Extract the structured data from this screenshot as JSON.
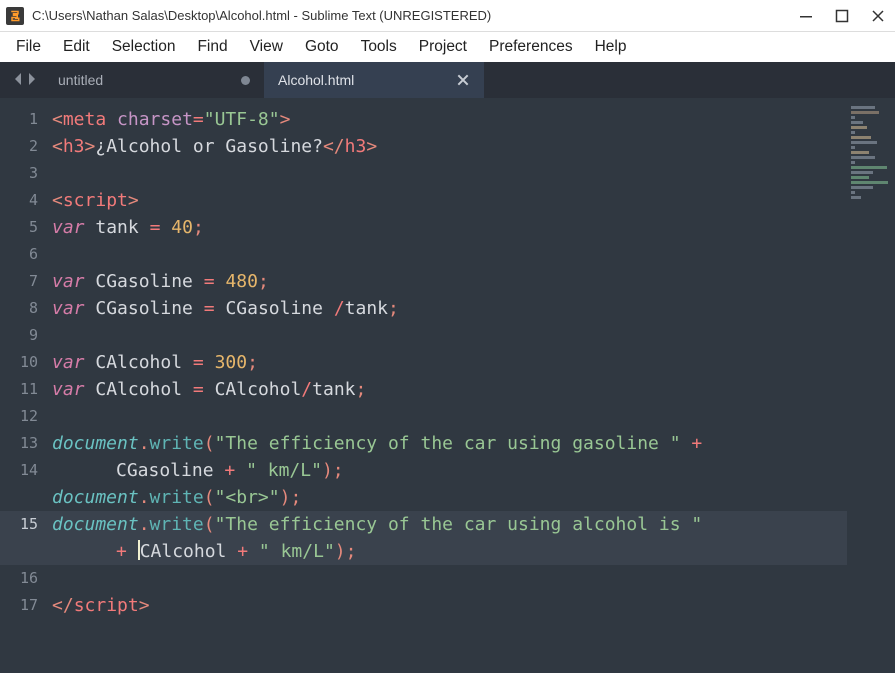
{
  "window": {
    "title": "C:\\Users\\Nathan Salas\\Desktop\\Alcohol.html - Sublime Text (UNREGISTERED)"
  },
  "menu": {
    "file": "File",
    "edit": "Edit",
    "selection": "Selection",
    "find": "Find",
    "view": "View",
    "goto": "Goto",
    "tools": "Tools",
    "project": "Project",
    "preferences": "Preferences",
    "help": "Help"
  },
  "tabs": {
    "t0": {
      "label": "untitled"
    },
    "t1": {
      "label": "Alcohol.html"
    }
  },
  "gutter": {
    "l1": "1",
    "l2": "2",
    "l3": "3",
    "l4": "4",
    "l5": "5",
    "l6": "6",
    "l7": "7",
    "l8": "8",
    "l9": "9",
    "l10": "10",
    "l11": "11",
    "l12": "12",
    "l13": "13",
    "l14": "14",
    "l15": "15",
    "l16": "16",
    "l17": "17"
  },
  "code": {
    "l1": {
      "tag_meta": "meta",
      "attr": "charset",
      "val": "\"UTF-8\""
    },
    "l2": {
      "tag_h3": "h3",
      "text": "¿Alcohol or Gasoline?"
    },
    "l4": {
      "tag_script": "script"
    },
    "l5": {
      "kw": "var",
      "id": "tank",
      "val": "40"
    },
    "l7": {
      "kw": "var",
      "id": "CGasoline",
      "val": "480"
    },
    "l8": {
      "kw": "var",
      "id": "CGasoline",
      "rhs1": "CGasoline ",
      "rhs2": "tank"
    },
    "l10": {
      "kw": "var",
      "id": "CAlcohol",
      "val": "300"
    },
    "l11": {
      "kw": "var",
      "id": "CAlcohol",
      "rhs1": "CAlcohol",
      "rhs2": "tank"
    },
    "l13": {
      "obj": "document",
      "fn": "write",
      "s1": "\"The efficiency of the car using gasoline \"",
      "wrap_id": "CGasoline",
      "s2": "\" km/L\""
    },
    "l14": {
      "obj": "document",
      "fn": "write",
      "s": "\"<br>\""
    },
    "l15": {
      "obj": "document",
      "fn": "write",
      "s1": "\"The efficiency of the car using alcohol is \"",
      "wrap_id": "CAlcohol",
      "s2": "\" km/L\""
    },
    "l17": {
      "tag_script": "script"
    }
  }
}
